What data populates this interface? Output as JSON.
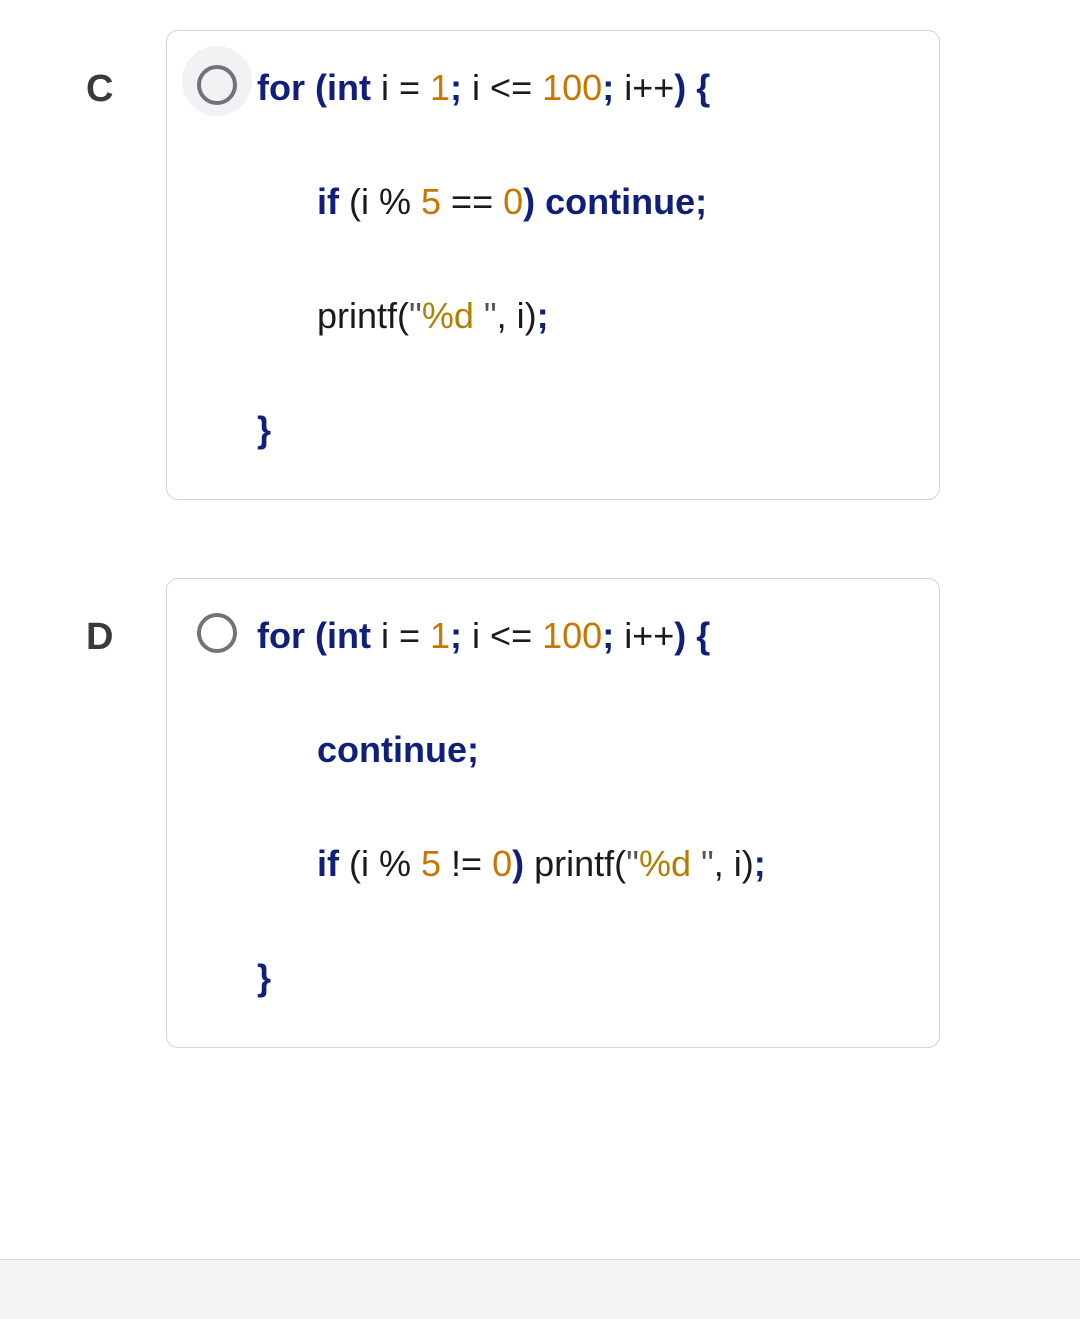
{
  "options": {
    "c": {
      "letter": "C",
      "halo": true,
      "tokens": {
        "l1_for": "for",
        "l1_op": " (",
        "l1_int": "int",
        "l1_ieq": " i = ",
        "l1_one": "1",
        "l1_semi1": ";",
        "l1_ile": " i <= ",
        "l1_hund": "100",
        "l1_semi2": ";",
        "l1_ipp": " i++",
        "l1_cp": ") {",
        "l2_if": "if",
        "l2_op": " (i % ",
        "l2_five": "5",
        "l2_eqeq": " == ",
        "l2_zero": "0",
        "l2_cp": ") ",
        "l2_cont": "continue",
        "l2_semi": ";",
        "l3_printf": "printf",
        "l3_op": "(",
        "l3_q1": "\"",
        "l3_fmt": "%d ",
        "l3_q2": "\"",
        "l3_ci": ", i)",
        "l3_semi": ";",
        "l4_brace": "}"
      }
    },
    "d": {
      "letter": "D",
      "halo": false,
      "tokens": {
        "l1_for": "for",
        "l1_op": " (",
        "l1_int": "int",
        "l1_ieq": " i = ",
        "l1_one": "1",
        "l1_semi1": ";",
        "l1_ile": " i <= ",
        "l1_hund": "100",
        "l1_semi2": ";",
        "l1_ipp": " i++",
        "l1_cp": ") {",
        "l2_cont": "continue",
        "l2_semi": ";",
        "l3_if": "if",
        "l3_op": " (i % ",
        "l3_five": "5",
        "l3_neq": " != ",
        "l3_zero": "0",
        "l3_cp": ") ",
        "l3_printf": "printf",
        "l3_op2": "(",
        "l3_q1": "\"",
        "l3_fmt": "%d ",
        "l3_q2": "\"",
        "l3_ci": ", i)",
        "l3_semi": ";",
        "l4_brace": "}"
      }
    }
  }
}
